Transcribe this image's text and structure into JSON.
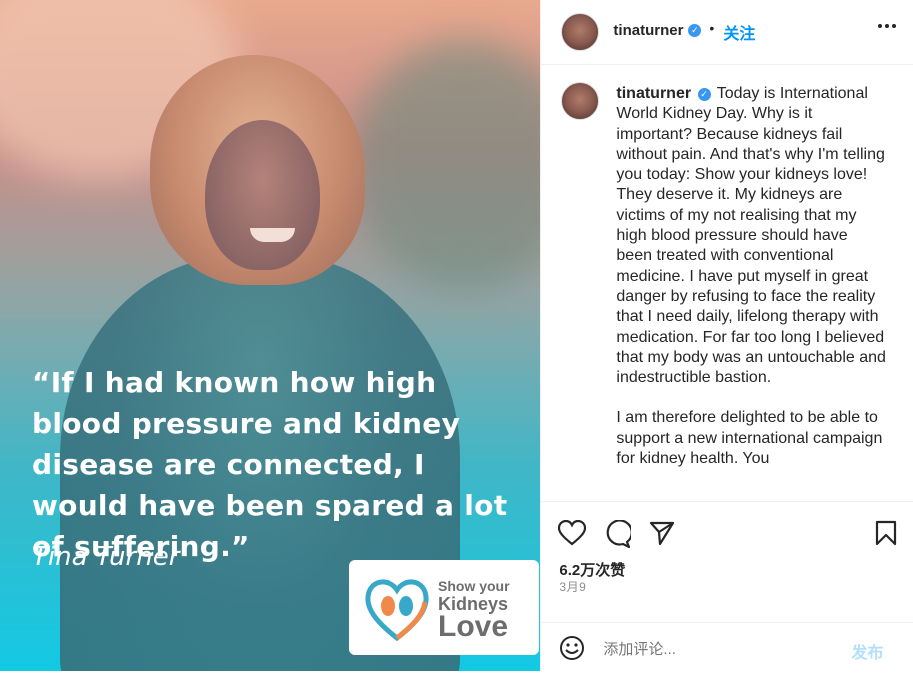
{
  "media": {
    "quote": "“If I had known how high blood pressure and kidney disease are connected, I would have been spared a lot of suffering.”",
    "author": "Tina Turner",
    "badge": {
      "line1": "Show your",
      "line2": "Kidneys",
      "line3": "Love"
    }
  },
  "header": {
    "username": "tinaturner",
    "separator": "•",
    "follow_label": "关注",
    "more_label": "•••"
  },
  "caption": {
    "username": "tinaturner",
    "paragraph1": "Today is International World Kidney Day. Why is it important? Because kidneys fail without pain. And that's why I'm telling you today: Show your kidneys love! They deserve it. My kidneys are victims of my not realising that my high blood pressure should have been treated with conventional medicine. I have put myself in great danger by refusing to face the reality that I need daily, lifelong therapy with medication. For far too long I believed that my body was an untouchable and indestructible bastion.",
    "paragraph2": "I am therefore delighted to be able to support a new international campaign for kidney health. You"
  },
  "actions": {
    "likes": "6.2万次赞",
    "date": "3月9"
  },
  "comment_box": {
    "placeholder": "添加评论...",
    "post_label": "发布"
  },
  "colors": {
    "follow": "#0095f6",
    "verified": "#3897f0",
    "post_disabled": "#b2dffc"
  }
}
